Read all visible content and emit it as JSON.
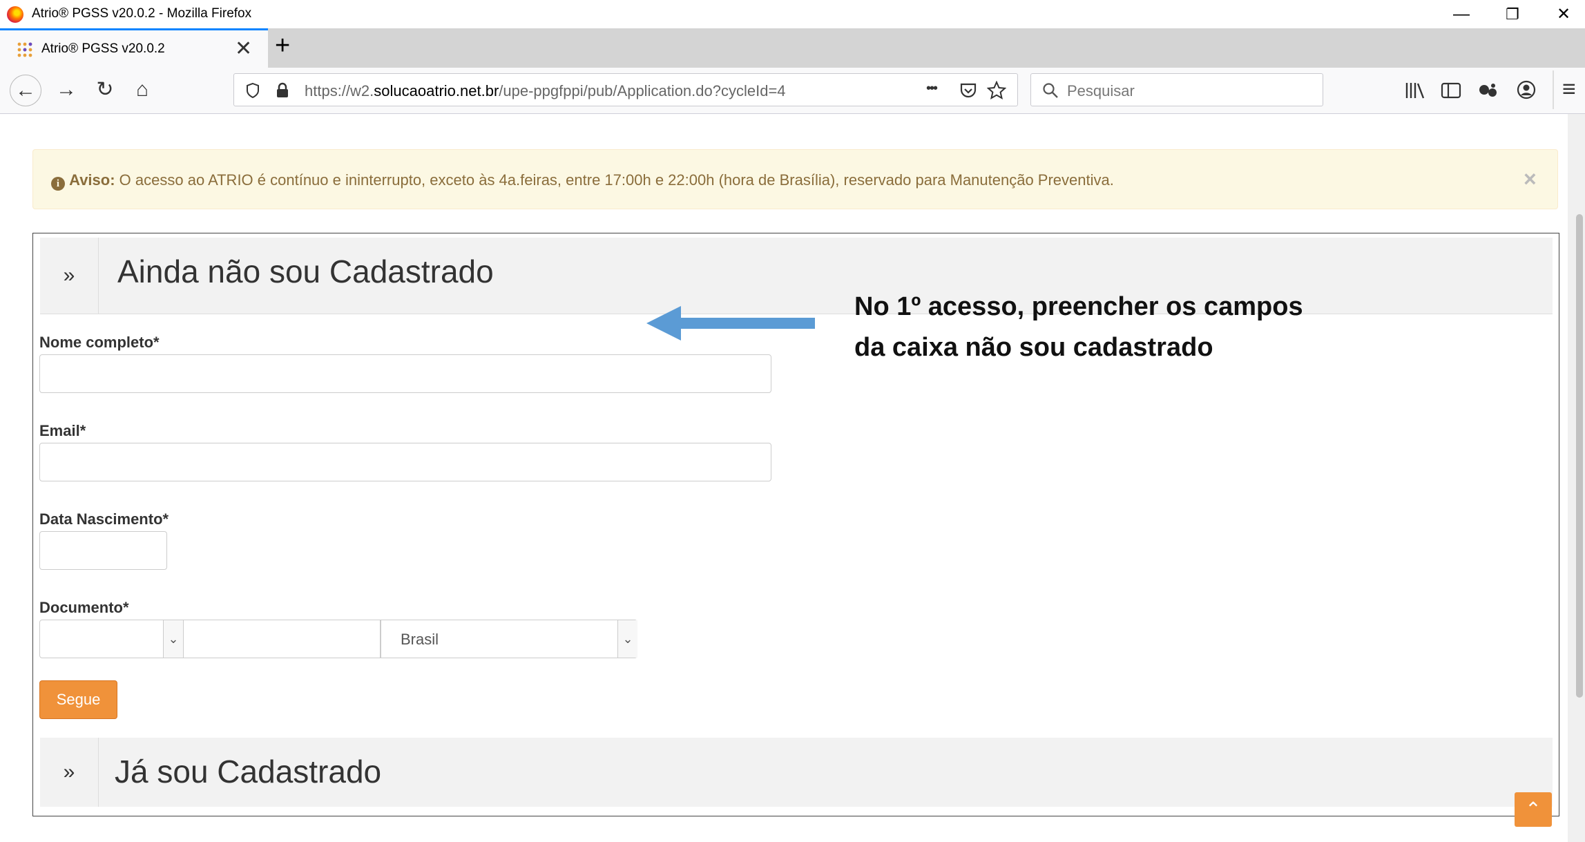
{
  "window": {
    "title": "Atrio® PGSS v20.0.2 - Mozilla Firefox",
    "minimize_glyph": "—",
    "restore_glyph": "❐",
    "close_glyph": "✕"
  },
  "tab": {
    "title": "Atrio® PGSS v20.0.2",
    "close_glyph": "✕",
    "new_tab_glyph": "+"
  },
  "nav": {
    "back_glyph": "←",
    "forward_glyph": "→",
    "reload_glyph": "↻",
    "home_glyph": "⌂",
    "url_prefix": "https://w2.",
    "url_domain": "solucaoatrio.net.br",
    "url_path": "/upe-ppgfppi/pub/Application.do?cycleId=4",
    "page_actions_glyph": "•••",
    "search_placeholder": "Pesquisar",
    "menu_glyph": "≡"
  },
  "alert": {
    "label": "Aviso:",
    "text": " O acesso ao ATRIO é contínuo e ininterrupto, exceto às 4a.feiras, entre 17:00h e 22:00h (hora de Brasília), reservado para Manutenção Preventiva.",
    "close_glyph": "×"
  },
  "register": {
    "chevron": "»",
    "heading": "Ainda não sou Cadastrado",
    "fields": {
      "name_label": "Nome completo*",
      "email_label": "Email*",
      "birth_label": "Data Nascimento*",
      "document_label": "Documento*",
      "country_value": "Brasil"
    },
    "submit_label": "Segue"
  },
  "login": {
    "chevron": "»",
    "heading": "Já sou Cadastrado"
  },
  "annotation": {
    "line1": "No 1º acesso, preencher os campos",
    "line2": "da caixa não sou cadastrado",
    "arrow_color": "#5b9bd5"
  },
  "scroll_top_glyph": "⌃",
  "colors": {
    "accent_orange": "#f0923a",
    "alert_bg": "#fcf8e3",
    "alert_text": "#8a6d3b",
    "firefox_tab_accent": "#0a84ff"
  }
}
